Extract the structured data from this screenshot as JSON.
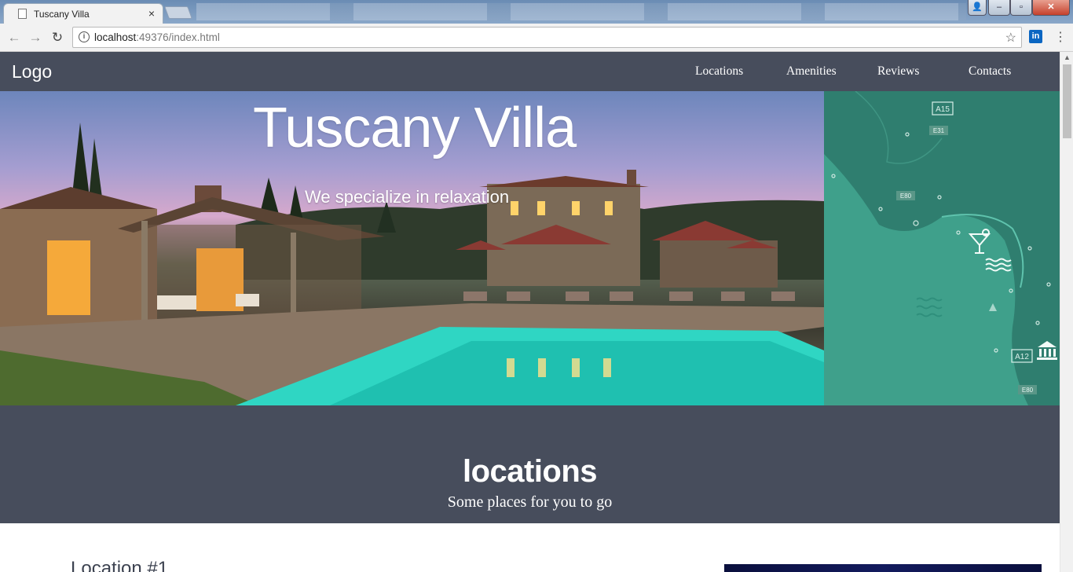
{
  "browser": {
    "tab_title": "Tuscany Villa",
    "tab_close": "×",
    "url_host": "localhost",
    "url_rest": ":49376/index.html",
    "info_glyph": "i",
    "star_glyph": "☆",
    "extension_label": "in",
    "menu_glyph": "⋮",
    "back_glyph": "←",
    "forward_glyph": "→",
    "reload_glyph": "↻",
    "window_controls": {
      "minimize": "–",
      "maximize": "▫",
      "close": "✕",
      "user": "👤"
    }
  },
  "site": {
    "logo": "Logo",
    "nav": [
      "Locations",
      "Amenities",
      "Reviews",
      "Contacts"
    ],
    "hero": {
      "title": "Tuscany Villa",
      "subtitle": "We specialize in relaxation"
    },
    "map_labels": [
      "A15",
      "E31",
      "E80",
      "A12",
      "E80"
    ],
    "locations_section": {
      "title": "locations",
      "subtitle": "Some places for you to go"
    },
    "location_1": {
      "title": "Location #1"
    }
  },
  "colors": {
    "nav_bg": "#474d5c",
    "map_sea": "#3fa08b",
    "map_land": "#2f7e6f",
    "text_light": "#ffffff"
  }
}
